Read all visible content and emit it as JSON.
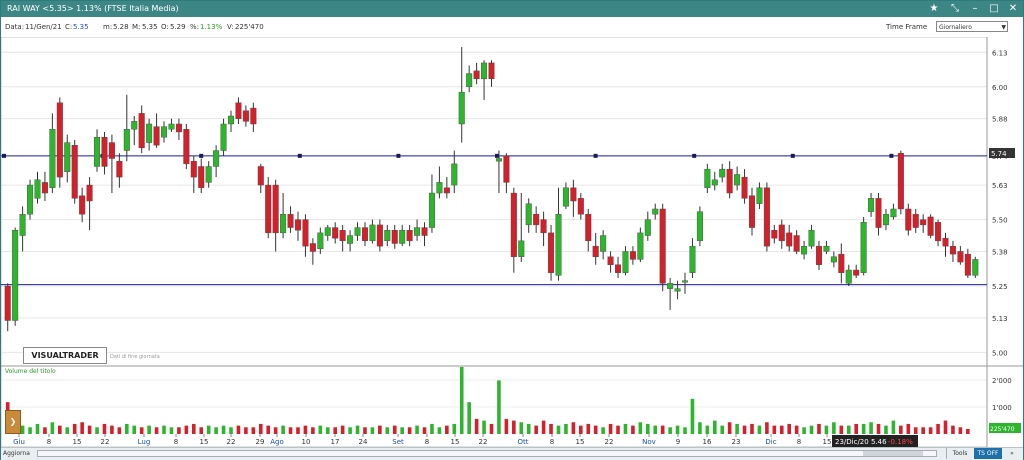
{
  "window": {
    "title": "RAI WAY <5.35> 1.13%  (FTSE Italia Media)",
    "buttons": [
      "star-icon",
      "pin-icon",
      "minimize-icon",
      "maximize-icon",
      "close-icon"
    ]
  },
  "info": {
    "data_label": "Data:",
    "data_value": "11/Gen/21",
    "c_label": "C:",
    "c_value": "5.35",
    "m_label": "m:",
    "m_value": "5.28",
    "M_label": "M:",
    "M_value": "5.35",
    "o_label": "O:",
    "o_value": "5.29",
    "pct_label": "%:",
    "pct_value": "1.13%",
    "v_label": "V:",
    "v_value": "225'470"
  },
  "timeframe": {
    "label": "Time Frame",
    "selected": "Giornaliero"
  },
  "overlay": {
    "logo": "VISUALTRADER",
    "logo_sub": "Dati di fine giornata",
    "volume_label": "Volume del titolo",
    "cursor_label": "23/Dic/20 5.46",
    "cursor_pct": "-0.18%",
    "price_marker": "5.74",
    "volume_marker": "225'470"
  },
  "status": {
    "aggiorna": "Aggiorna",
    "tools": "Tools",
    "tsoff": "TS OFF",
    "more": "»"
  },
  "colors": {
    "up": "#2db52d",
    "down": "#d4202a",
    "trendline": "#1f1fa0",
    "titlebar": "#3d8686"
  },
  "chart_data": {
    "type": "candlestick",
    "price_axis": {
      "ticks": [
        6.13,
        6.0,
        5.88,
        5.74,
        5.63,
        5.5,
        5.38,
        5.25,
        5.13,
        5.0
      ],
      "min": 4.96,
      "max": 6.18
    },
    "volume_axis": {
      "ticks": [
        "2'000",
        "1'000"
      ]
    },
    "x_ticks": [
      "Giu",
      "8",
      "15",
      "22",
      "Lug",
      "8",
      "15",
      "22",
      "29",
      "Ago",
      "10",
      "17",
      "24",
      "Set",
      "8",
      "15",
      "22",
      "Ott",
      "8",
      "15",
      "22",
      "Nov",
      "9",
      "16",
      "23",
      "Dic",
      "8",
      "15"
    ],
    "x_tick_month": [
      true,
      false,
      false,
      false,
      true,
      false,
      false,
      false,
      false,
      true,
      false,
      false,
      false,
      true,
      false,
      false,
      false,
      true,
      false,
      false,
      false,
      true,
      false,
      false,
      false,
      true,
      false,
      false
    ],
    "horizontal_lines": [
      5.74,
      5.255
    ],
    "candles": [
      {
        "o": 5.25,
        "c": 5.12,
        "h": 5.26,
        "l": 5.08
      },
      {
        "o": 5.12,
        "c": 5.46,
        "h": 5.47,
        "l": 5.1
      },
      {
        "o": 5.44,
        "c": 5.52,
        "h": 5.55,
        "l": 5.38
      },
      {
        "o": 5.52,
        "c": 5.63,
        "h": 5.65,
        "l": 5.5
      },
      {
        "o": 5.58,
        "c": 5.65,
        "h": 5.68,
        "l": 5.56
      },
      {
        "o": 5.64,
        "c": 5.6,
        "h": 5.68,
        "l": 5.57
      },
      {
        "o": 5.62,
        "c": 5.84,
        "h": 5.9,
        "l": 5.6
      },
      {
        "o": 5.94,
        "c": 5.66,
        "h": 5.96,
        "l": 5.62
      },
      {
        "o": 5.68,
        "c": 5.79,
        "h": 5.82,
        "l": 5.64
      },
      {
        "o": 5.78,
        "c": 5.58,
        "h": 5.8,
        "l": 5.56
      },
      {
        "o": 5.59,
        "c": 5.52,
        "h": 5.62,
        "l": 5.49
      },
      {
        "o": 5.63,
        "c": 5.57,
        "h": 5.66,
        "l": 5.46
      },
      {
        "o": 5.7,
        "c": 5.81,
        "h": 5.84,
        "l": 5.68
      },
      {
        "o": 5.81,
        "c": 5.7,
        "h": 5.83,
        "l": 5.67
      },
      {
        "o": 5.79,
        "c": 5.73,
        "h": 5.82,
        "l": 5.6
      },
      {
        "o": 5.72,
        "c": 5.66,
        "h": 5.75,
        "l": 5.62
      },
      {
        "o": 5.76,
        "c": 5.84,
        "h": 5.97,
        "l": 5.72
      },
      {
        "o": 5.84,
        "c": 5.87,
        "h": 5.89,
        "l": 5.78
      },
      {
        "o": 5.9,
        "c": 5.77,
        "h": 5.93,
        "l": 5.75
      },
      {
        "o": 5.79,
        "c": 5.86,
        "h": 5.88,
        "l": 5.76
      },
      {
        "o": 5.85,
        "c": 5.78,
        "h": 5.9,
        "l": 5.77
      },
      {
        "o": 5.81,
        "c": 5.85,
        "h": 5.87,
        "l": 5.79
      },
      {
        "o": 5.84,
        "c": 5.86,
        "h": 5.88,
        "l": 5.83
      },
      {
        "o": 5.86,
        "c": 5.83,
        "h": 5.88,
        "l": 5.8
      },
      {
        "o": 5.84,
        "c": 5.71,
        "h": 5.86,
        "l": 5.69
      },
      {
        "o": 5.72,
        "c": 5.66,
        "h": 5.74,
        "l": 5.6
      },
      {
        "o": 5.7,
        "c": 5.62,
        "h": 5.73,
        "l": 5.6
      },
      {
        "o": 5.64,
        "c": 5.7,
        "h": 5.72,
        "l": 5.62
      },
      {
        "o": 5.7,
        "c": 5.76,
        "h": 5.78,
        "l": 5.66
      },
      {
        "o": 5.76,
        "c": 5.86,
        "h": 5.88,
        "l": 5.74
      },
      {
        "o": 5.86,
        "c": 5.89,
        "h": 5.91,
        "l": 5.83
      },
      {
        "o": 5.94,
        "c": 5.88,
        "h": 5.96,
        "l": 5.86
      },
      {
        "o": 5.91,
        "c": 5.87,
        "h": 5.93,
        "l": 5.85
      },
      {
        "o": 5.92,
        "c": 5.86,
        "h": 5.94,
        "l": 5.83
      },
      {
        "o": 5.7,
        "c": 5.63,
        "h": 5.71,
        "l": 5.6
      },
      {
        "o": 5.63,
        "c": 5.45,
        "h": 5.66,
        "l": 5.43
      },
      {
        "o": 5.63,
        "c": 5.45,
        "h": 5.65,
        "l": 5.38
      },
      {
        "o": 5.45,
        "c": 5.52,
        "h": 5.6,
        "l": 5.43
      },
      {
        "o": 5.52,
        "c": 5.47,
        "h": 5.55,
        "l": 5.45
      },
      {
        "o": 5.5,
        "c": 5.46,
        "h": 5.53,
        "l": 5.42
      },
      {
        "o": 5.5,
        "c": 5.4,
        "h": 5.52,
        "l": 5.36
      },
      {
        "o": 5.41,
        "c": 5.38,
        "h": 5.43,
        "l": 5.33
      },
      {
        "o": 5.39,
        "c": 5.45,
        "h": 5.47,
        "l": 5.37
      },
      {
        "o": 5.44,
        "c": 5.47,
        "h": 5.48,
        "l": 5.42
      },
      {
        "o": 5.47,
        "c": 5.43,
        "h": 5.49,
        "l": 5.41
      },
      {
        "o": 5.46,
        "c": 5.42,
        "h": 5.48,
        "l": 5.38
      },
      {
        "o": 5.41,
        "c": 5.44,
        "h": 5.46,
        "l": 5.38
      },
      {
        "o": 5.44,
        "c": 5.47,
        "h": 5.49,
        "l": 5.42
      },
      {
        "o": 5.47,
        "c": 5.42,
        "h": 5.49,
        "l": 5.4
      },
      {
        "o": 5.42,
        "c": 5.48,
        "h": 5.5,
        "l": 5.41
      },
      {
        "o": 5.48,
        "c": 5.4,
        "h": 5.5,
        "l": 5.38
      },
      {
        "o": 5.42,
        "c": 5.46,
        "h": 5.48,
        "l": 5.4
      },
      {
        "o": 5.46,
        "c": 5.41,
        "h": 5.48,
        "l": 5.39
      },
      {
        "o": 5.41,
        "c": 5.46,
        "h": 5.48,
        "l": 5.4
      },
      {
        "o": 5.46,
        "c": 5.42,
        "h": 5.48,
        "l": 5.4
      },
      {
        "o": 5.44,
        "c": 5.47,
        "h": 5.5,
        "l": 5.42
      },
      {
        "o": 5.47,
        "c": 5.44,
        "h": 5.49,
        "l": 5.4
      },
      {
        "o": 5.47,
        "c": 5.6,
        "h": 5.67,
        "l": 5.45
      },
      {
        "o": 5.6,
        "c": 5.64,
        "h": 5.7,
        "l": 5.58
      },
      {
        "o": 5.62,
        "c": 5.6,
        "h": 5.66,
        "l": 5.58
      },
      {
        "o": 5.63,
        "c": 5.71,
        "h": 5.76,
        "l": 5.6
      },
      {
        "o": 5.86,
        "c": 5.98,
        "h": 6.15,
        "l": 5.79
      },
      {
        "o": 6.0,
        "c": 6.05,
        "h": 6.08,
        "l": 5.98
      },
      {
        "o": 6.06,
        "c": 6.03,
        "h": 6.09,
        "l": 6.01
      },
      {
        "o": 6.03,
        "c": 6.09,
        "h": 6.1,
        "l": 5.95
      },
      {
        "o": 6.09,
        "c": 6.03,
        "h": 6.1,
        "l": 6.0
      },
      {
        "o": 5.72,
        "c": 5.73,
        "h": 5.76,
        "l": 5.6
      },
      {
        "o": 5.74,
        "c": 5.64,
        "h": 5.75,
        "l": 5.6
      },
      {
        "o": 5.6,
        "c": 5.36,
        "h": 5.62,
        "l": 5.3
      },
      {
        "o": 5.36,
        "c": 5.42,
        "h": 5.6,
        "l": 5.34
      },
      {
        "o": 5.48,
        "c": 5.56,
        "h": 5.58,
        "l": 5.45
      },
      {
        "o": 5.52,
        "c": 5.48,
        "h": 5.55,
        "l": 5.45
      },
      {
        "o": 5.5,
        "c": 5.45,
        "h": 5.53,
        "l": 5.4
      },
      {
        "o": 5.45,
        "c": 5.3,
        "h": 5.48,
        "l": 5.27
      },
      {
        "o": 5.29,
        "c": 5.52,
        "h": 5.62,
        "l": 5.27
      },
      {
        "o": 5.55,
        "c": 5.62,
        "h": 5.64,
        "l": 5.54
      },
      {
        "o": 5.62,
        "c": 5.57,
        "h": 5.65,
        "l": 5.51
      },
      {
        "o": 5.58,
        "c": 5.52,
        "h": 5.6,
        "l": 5.5
      },
      {
        "o": 5.52,
        "c": 5.42,
        "h": 5.54,
        "l": 5.38
      },
      {
        "o": 5.4,
        "c": 5.36,
        "h": 5.45,
        "l": 5.33
      },
      {
        "o": 5.38,
        "c": 5.44,
        "h": 5.46,
        "l": 5.35
      },
      {
        "o": 5.36,
        "c": 5.33,
        "h": 5.38,
        "l": 5.3
      },
      {
        "o": 5.33,
        "c": 5.3,
        "h": 5.36,
        "l": 5.28
      },
      {
        "o": 5.3,
        "c": 5.38,
        "h": 5.4,
        "l": 5.29
      },
      {
        "o": 5.38,
        "c": 5.35,
        "h": 5.4,
        "l": 5.33
      },
      {
        "o": 5.35,
        "c": 5.45,
        "h": 5.47,
        "l": 5.34
      },
      {
        "o": 5.44,
        "c": 5.5,
        "h": 5.53,
        "l": 5.42
      },
      {
        "o": 5.52,
        "c": 5.54,
        "h": 5.56,
        "l": 5.5
      },
      {
        "o": 5.54,
        "c": 5.26,
        "h": 5.56,
        "l": 5.23
      },
      {
        "o": 5.24,
        "c": 5.26,
        "h": 5.28,
        "l": 5.16
      },
      {
        "o": 5.23,
        "c": 5.24,
        "h": 5.27,
        "l": 5.2
      },
      {
        "o": 5.27,
        "c": 5.27,
        "h": 5.3,
        "l": 5.22
      },
      {
        "o": 5.3,
        "c": 5.4,
        "h": 5.43,
        "l": 5.28
      },
      {
        "o": 5.42,
        "c": 5.53,
        "h": 5.55,
        "l": 5.4
      },
      {
        "o": 5.62,
        "c": 5.69,
        "h": 5.71,
        "l": 5.6
      },
      {
        "o": 5.63,
        "c": 5.65,
        "h": 5.68,
        "l": 5.61
      },
      {
        "o": 5.66,
        "c": 5.69,
        "h": 5.71,
        "l": 5.64
      },
      {
        "o": 5.69,
        "c": 5.6,
        "h": 5.72,
        "l": 5.58
      },
      {
        "o": 5.63,
        "c": 5.67,
        "h": 5.7,
        "l": 5.61
      },
      {
        "o": 5.66,
        "c": 5.58,
        "h": 5.69,
        "l": 5.56
      },
      {
        "o": 5.59,
        "c": 5.47,
        "h": 5.62,
        "l": 5.44
      },
      {
        "o": 5.56,
        "c": 5.62,
        "h": 5.64,
        "l": 5.54
      },
      {
        "o": 5.62,
        "c": 5.4,
        "h": 5.64,
        "l": 5.38
      },
      {
        "o": 5.46,
        "c": 5.43,
        "h": 5.48,
        "l": 5.41
      },
      {
        "o": 5.48,
        "c": 5.42,
        "h": 5.5,
        "l": 5.39
      },
      {
        "o": 5.45,
        "c": 5.4,
        "h": 5.48,
        "l": 5.38
      },
      {
        "o": 5.44,
        "c": 5.38,
        "h": 5.46,
        "l": 5.37
      },
      {
        "o": 5.37,
        "c": 5.4,
        "h": 5.42,
        "l": 5.35
      },
      {
        "o": 5.4,
        "c": 5.46,
        "h": 5.48,
        "l": 5.39
      },
      {
        "o": 5.4,
        "c": 5.33,
        "h": 5.42,
        "l": 5.31
      },
      {
        "o": 5.38,
        "c": 5.4,
        "h": 5.42,
        "l": 5.37
      },
      {
        "o": 5.34,
        "c": 5.36,
        "h": 5.38,
        "l": 5.32
      },
      {
        "o": 5.37,
        "c": 5.3,
        "h": 5.41,
        "l": 5.26
      },
      {
        "o": 5.26,
        "c": 5.31,
        "h": 5.33,
        "l": 5.25
      },
      {
        "o": 5.31,
        "c": 5.29,
        "h": 5.33,
        "l": 5.28
      },
      {
        "o": 5.3,
        "c": 5.49,
        "h": 5.51,
        "l": 5.29
      },
      {
        "o": 5.53,
        "c": 5.58,
        "h": 5.6,
        "l": 5.51
      },
      {
        "o": 5.58,
        "c": 5.47,
        "h": 5.6,
        "l": 5.44
      },
      {
        "o": 5.48,
        "c": 5.52,
        "h": 5.54,
        "l": 5.46
      },
      {
        "o": 5.51,
        "c": 5.54,
        "h": 5.56,
        "l": 5.5
      },
      {
        "o": 5.75,
        "c": 5.54,
        "h": 5.76,
        "l": 5.52
      },
      {
        "o": 5.54,
        "c": 5.46,
        "h": 5.56,
        "l": 5.44
      },
      {
        "o": 5.52,
        "c": 5.47,
        "h": 5.54,
        "l": 5.45
      },
      {
        "o": 5.5,
        "c": 5.48,
        "h": 5.52,
        "l": 5.45
      },
      {
        "o": 5.51,
        "c": 5.44,
        "h": 5.52,
        "l": 5.43
      },
      {
        "o": 5.49,
        "c": 5.42,
        "h": 5.5,
        "l": 5.4
      },
      {
        "o": 5.43,
        "c": 5.4,
        "h": 5.45,
        "l": 5.36
      },
      {
        "o": 5.4,
        "c": 5.37,
        "h": 5.42,
        "l": 5.34
      },
      {
        "o": 5.38,
        "c": 5.34,
        "h": 5.4,
        "l": 5.33
      },
      {
        "o": 5.37,
        "c": 5.29,
        "h": 5.39,
        "l": 5.28
      },
      {
        "o": 5.29,
        "c": 5.35,
        "h": 5.36,
        "l": 5.28
      }
    ],
    "volumes": [
      95,
      60,
      25,
      20,
      30,
      20,
      35,
      25,
      20,
      30,
      35,
      25,
      20,
      30,
      25,
      20,
      30,
      25,
      20,
      25,
      20,
      25,
      20,
      20,
      25,
      30,
      20,
      25,
      20,
      25,
      20,
      25,
      20,
      20,
      30,
      25,
      20,
      25,
      20,
      20,
      25,
      20,
      25,
      20,
      20,
      25,
      20,
      25,
      20,
      20,
      25,
      20,
      25,
      20,
      20,
      25,
      20,
      30,
      20,
      25,
      30,
      200,
      95,
      45,
      40,
      30,
      160,
      45,
      40,
      35,
      30,
      25,
      40,
      30,
      25,
      30,
      35,
      25,
      30,
      25,
      20,
      30,
      25,
      30,
      25,
      35,
      30,
      25,
      25,
      20,
      25,
      20,
      105,
      35,
      25,
      40,
      25,
      35,
      30,
      25,
      30,
      25,
      35,
      25,
      25,
      30,
      25,
      20,
      25,
      30,
      25,
      35,
      25,
      25,
      30,
      30,
      35,
      30,
      25,
      40,
      25,
      30,
      20,
      20,
      20,
      30,
      40,
      25,
      20,
      15
    ]
  }
}
